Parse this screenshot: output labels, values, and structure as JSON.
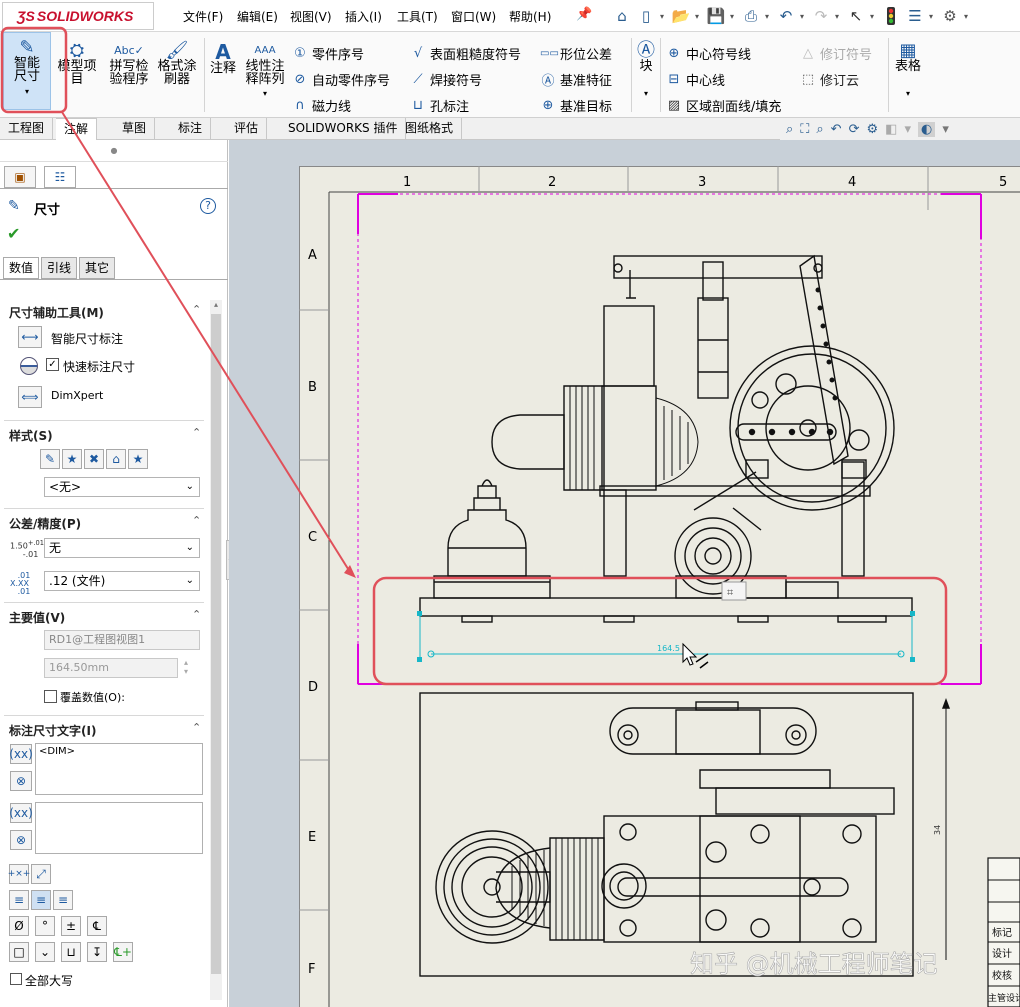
{
  "app": {
    "logo": "SOLIDWORKS"
  },
  "menu": [
    "文件(F)",
    "编辑(E)",
    "视图(V)",
    "插入(I)",
    "工具(T)",
    "窗口(W)",
    "帮助(H)"
  ],
  "ribbon": {
    "smart_dim": "智能尺寸",
    "model_items": "模型项目",
    "spell_check": "拼写检验程序",
    "format_painter": "格式涂刷器",
    "note": "注释",
    "linear_note": "线性注释阵列",
    "col1": [
      "零件序号",
      "自动零件序号",
      "磁力线"
    ],
    "col2": [
      "表面粗糙度符号",
      "焊接符号",
      "孔标注"
    ],
    "col3": [
      "形位公差",
      "基准特征",
      "基准目标"
    ],
    "block": "块",
    "col4": [
      "中心符号线",
      "中心线",
      "区域剖面线/填充"
    ],
    "col5": [
      "修订符号",
      "修订云"
    ],
    "table": "表格"
  },
  "tabs": [
    "工程图",
    "注解",
    "草图",
    "标注",
    "评估",
    "SOLIDWORKS 插件",
    "图纸格式"
  ],
  "panel": {
    "title": "尺寸",
    "subtabs": [
      "数值",
      "引线",
      "其它"
    ],
    "section_tools": "尺寸辅助工具(M)",
    "smart_dim_label": "智能尺寸标注",
    "quick_dim_label": "快速标注尺寸",
    "dimxpert_label": "DimXpert",
    "section_style": "样式(S)",
    "style_value": "<无>",
    "section_tolerance": "公差/精度(P)",
    "tol_value": "无",
    "precision_value": ".12 (文件)",
    "section_primary": "主要值(V)",
    "primary_ref": "RD1@工程图视图1",
    "primary_value": "164.50mm",
    "override_label": "覆盖数值(O):",
    "section_dim_text": "标注尺寸文字(I)",
    "dim_text": "<DIM>",
    "all_caps": "全部大写"
  },
  "sheet": {
    "col_labels": [
      "1",
      "2",
      "3",
      "4",
      "5"
    ],
    "row_labels": [
      "A",
      "B",
      "C",
      "D",
      "E",
      "F"
    ],
    "dim_text": "164.5",
    "title_block": [
      "标记",
      "设计",
      "校核",
      "主管设计"
    ]
  },
  "watermark": "知乎 @机械工程师笔记",
  "colors": {
    "highlight": "#e0505a",
    "selection": "#e000e0",
    "dimension": "#17b7c8",
    "accent": "#1e5aa0"
  }
}
